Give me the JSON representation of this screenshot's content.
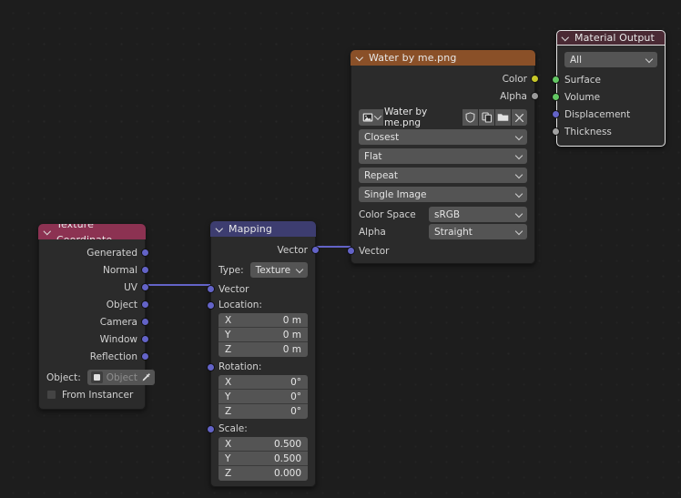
{
  "editor": {
    "name": "blender-shader-node-editor",
    "background_color": "#1d1d1d"
  },
  "nodes": [
    {
      "id": "texture-coordinate",
      "title": "Texture Coordinate",
      "header_color": "#8c3252",
      "outputs": [
        "Generated",
        "Normal",
        "UV",
        "Object",
        "Camera",
        "Window",
        "Reflection"
      ],
      "object_label": "Object:",
      "object_value": "Object",
      "from_instancer_label": "From Instancer"
    },
    {
      "id": "mapping",
      "title": "Mapping",
      "header_color": "#3d3d70",
      "output_label": "Vector",
      "type_label": "Type:",
      "type_value": "Texture",
      "input_label": "Vector",
      "location_label": "Location:",
      "location": [
        {
          "axis": "X",
          "value": "0 m"
        },
        {
          "axis": "Y",
          "value": "0 m"
        },
        {
          "axis": "Z",
          "value": "0 m"
        }
      ],
      "rotation_label": "Rotation:",
      "rotation": [
        {
          "axis": "X",
          "value": "0°"
        },
        {
          "axis": "Y",
          "value": "0°"
        },
        {
          "axis": "Z",
          "value": "0°"
        }
      ],
      "scale_label": "Scale:",
      "scale": [
        {
          "axis": "X",
          "value": "0.500"
        },
        {
          "axis": "Y",
          "value": "0.500"
        },
        {
          "axis": "Z",
          "value": "0.000"
        }
      ]
    },
    {
      "id": "image-texture",
      "title": "Water by me.png",
      "header_color": "#8a5028",
      "outputs": [
        {
          "label": "Color",
          "socket": "color"
        },
        {
          "label": "Alpha",
          "socket": "gray"
        }
      ],
      "image_name": "Water by me.png",
      "interpolation": "Closest",
      "projection": "Flat",
      "extension": "Repeat",
      "source": "Single Image",
      "color_space_label": "Color Space",
      "color_space_value": "sRGB",
      "alpha_label": "Alpha",
      "alpha_value": "Straight",
      "input_label": "Vector",
      "icons": [
        "image-browse-icon",
        "chevron-down-icon",
        "shield-icon",
        "duplicate-icon",
        "folder-open-icon",
        "unlink-x-icon"
      ]
    },
    {
      "id": "material-output",
      "title": "Material Output",
      "header_color": "#4a2a34",
      "target_value": "All",
      "inputs": [
        {
          "label": "Surface",
          "socket": "shader"
        },
        {
          "label": "Volume",
          "socket": "shader"
        },
        {
          "label": "Displacement",
          "socket": "vector"
        },
        {
          "label": "Thickness",
          "socket": "float"
        }
      ],
      "selected": true
    }
  ],
  "links": [
    {
      "from": "texture-coordinate.UV",
      "to": "mapping.Vector",
      "color": "#6363c7"
    },
    {
      "from": "mapping.Vector",
      "to": "image-texture.Vector",
      "color": "#6363c7"
    },
    {
      "from": "image-texture.Color",
      "to": "material-output.Surface",
      "color_from": "#c7c729",
      "color_to": "#63c763"
    }
  ],
  "socket_colors": {
    "vector": "#6363c7",
    "color": "#c7c729",
    "gray": "#9a9a9a",
    "shader": "#63c763",
    "float": "#a1a1a1"
  }
}
